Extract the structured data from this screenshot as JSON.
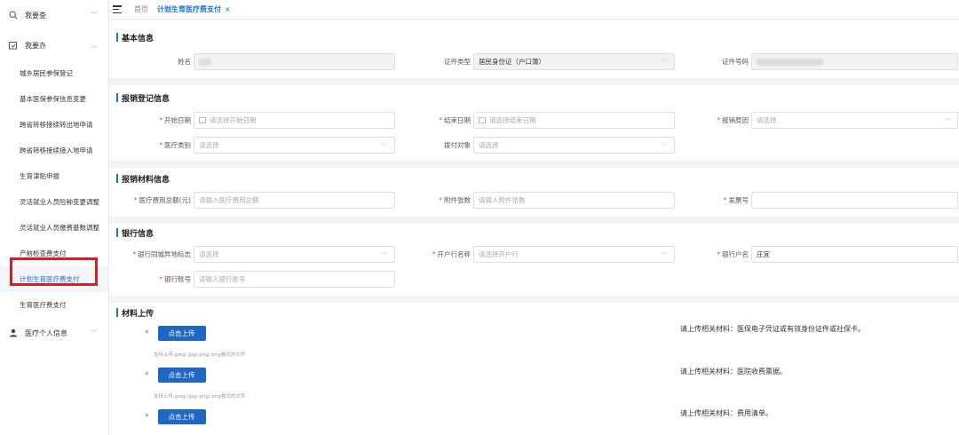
{
  "sidebar": {
    "groups": [
      {
        "label": "我要查",
        "chevron": "﹀"
      },
      {
        "label": "我要办",
        "chevron": "︿"
      }
    ],
    "items": [
      {
        "label": "城乡居民参保登记"
      },
      {
        "label": "基本医保参保信息变更"
      },
      {
        "label": "跨省转移接续转出地申请"
      },
      {
        "label": "跨省转移接续接入地申请"
      },
      {
        "label": "生育津贴申报"
      },
      {
        "label": "灵活就业人员险种变更调整"
      },
      {
        "label": "灵活就业人员缴费基数调整"
      },
      {
        "label": "产前检查费支付"
      },
      {
        "label": "计划生育医疗费支付"
      },
      {
        "label": "生育医疗费支付"
      }
    ],
    "personal": {
      "label": "医疗个人信息",
      "chevron": "﹀"
    }
  },
  "topbar": {
    "home": "首页",
    "active_tab": "计划生育医疗费支付",
    "close": "×"
  },
  "basic": {
    "title": "基本信息",
    "name_label": "姓名",
    "cert_type_label": "证件类型",
    "cert_type_value": "居民身份证（户口簿）",
    "cert_no_label": "证件号码"
  },
  "reg": {
    "title": "报销登记信息",
    "start_label": "开始日期",
    "start_ph": "请选择开始日期",
    "end_label": "结束日期",
    "end_ph": "请选择结束日期",
    "reason_label": "报销原因",
    "reason_ph": "请选择",
    "med_type_label": "医疗类别",
    "med_type_ph": "请选择",
    "pay_target_label": "拨付对象",
    "pay_target_ph": "请选择"
  },
  "material": {
    "title": "报销材料信息",
    "total_label": "医疗费用总额(元)",
    "total_ph": "请输入医疗费用总额",
    "attach_label": "附件张数",
    "attach_ph": "请输入附件张数",
    "invoice_label": "发票号"
  },
  "bank": {
    "title": "银行信息",
    "region_label": "银行同城异地标志",
    "region_ph": "请选择",
    "branch_label": "开户行名称",
    "branch_ph": "请选择开户行",
    "holder_label": "银行户名",
    "holder_value": "庄宜",
    "account_label": "银行账号",
    "account_ph": "请输入银行账号"
  },
  "upload": {
    "title": "材料上传",
    "button": "点击上传",
    "hint": "支持上传.jpeg/.jpg/.png/.bng格式的文件",
    "notes": [
      "请上传相关材料：医保电子凭证或有效身份证件或社保卡。",
      "请上传相关材料：医院收费票据。",
      "请上传相关材料：费用清单。"
    ]
  },
  "colors": {
    "accent": "#1a6fd9",
    "button": "#1f67c4",
    "required": "#e84c3d",
    "highlight_box": "#d31f26"
  }
}
